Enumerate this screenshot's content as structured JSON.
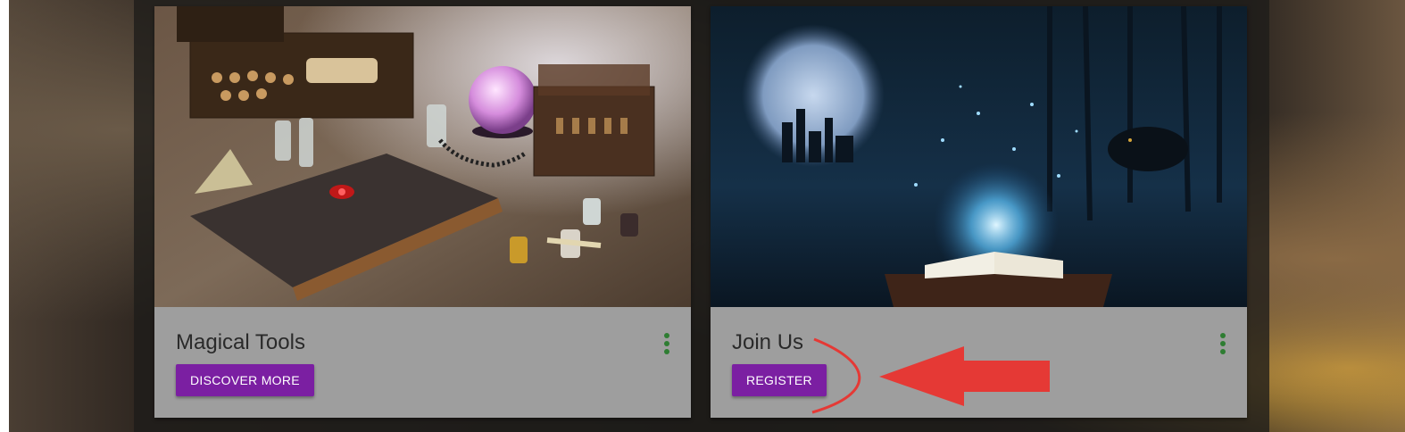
{
  "cards": [
    {
      "title": "Magical Tools",
      "button_label": "DISCOVER MORE",
      "image": "magical-tools-photo"
    },
    {
      "title": "Join Us",
      "button_label": "REGISTER",
      "image": "glowing-book-fantasy-photo"
    }
  ],
  "colors": {
    "button": "#7b1fa2",
    "menu_dots": "#2e7d32",
    "card_content_bg": "#9e9e9e",
    "annotation": "#e53935"
  },
  "icons": [
    "more-vert-icon",
    "annotation-arrow-icon"
  ]
}
